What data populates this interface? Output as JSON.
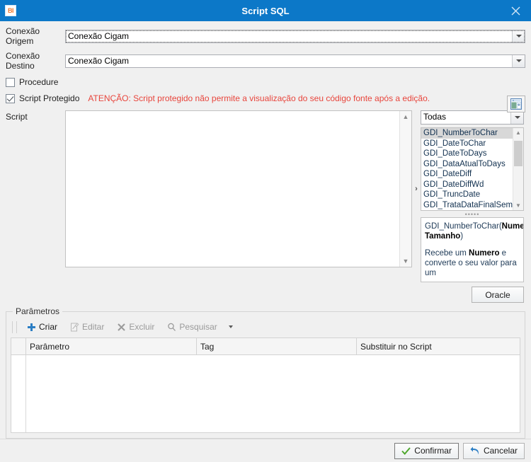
{
  "window": {
    "title": "Script SQL",
    "app_icon": "BI",
    "close_icon": "close-icon",
    "accent_color": "#0c78c8",
    "warning_color": "#e8453c"
  },
  "form": {
    "origem_label": "Conexão Origem",
    "origem_value": "Conexão Cigam",
    "destino_label": "Conexão Destino",
    "destino_value": "Conexão Cigam",
    "procedure_label": "Procedure",
    "procedure_checked": false,
    "script_protegido_label": "Script Protegido",
    "script_protegido_checked": true,
    "warning": "ATENÇÃO: Script protegido não permite a visualização do seu código fonte após a edição."
  },
  "script": {
    "label": "Script",
    "value": "",
    "expander_icon": "chevron-right-icon",
    "scroll_up_icon": "chevron-up-icon",
    "scroll_down_icon": "chevron-down-icon"
  },
  "functions": {
    "filter_value": "Todas",
    "items": [
      "GDI_NumberToChar",
      "GDI_DateToChar",
      "GDI_DateToDays",
      "GDI_DataAtualToDays",
      "GDI_DateDiff",
      "GDI_DateDiffWd",
      "GDI_TruncDate",
      "GDI_TrataDataFinalSemana"
    ],
    "selected_index": 0,
    "splitter_dots": "•••••",
    "description": {
      "signature_prefix": "GDI_NumberToChar(",
      "signature_args": "Numero, Tamanho",
      "signature_suffix": ")",
      "body_prefix": "Recebe um ",
      "body_bold": "Numero",
      "body_suffix": " e converte o seu valor para um"
    },
    "oracle_button": "Oracle"
  },
  "parametros": {
    "group_title": "Parâmetros",
    "toolbar": [
      {
        "label": "Criar",
        "icon": "plus-icon",
        "disabled": false
      },
      {
        "label": "Editar",
        "icon": "edit-icon",
        "disabled": true
      },
      {
        "label": "Excluir",
        "icon": "x-icon",
        "disabled": true
      },
      {
        "label": "Pesquisar",
        "icon": "search-icon",
        "disabled": true
      }
    ],
    "overflow_icon": "chevron-down-icon",
    "columns": [
      "Parâmetro",
      "Tag",
      "Substituir no Script"
    ],
    "rows": []
  },
  "footer": {
    "confirm_label": "Confirmar",
    "confirm_icon": "check-icon",
    "cancel_label": "Cancelar",
    "cancel_icon": "undo-icon"
  }
}
